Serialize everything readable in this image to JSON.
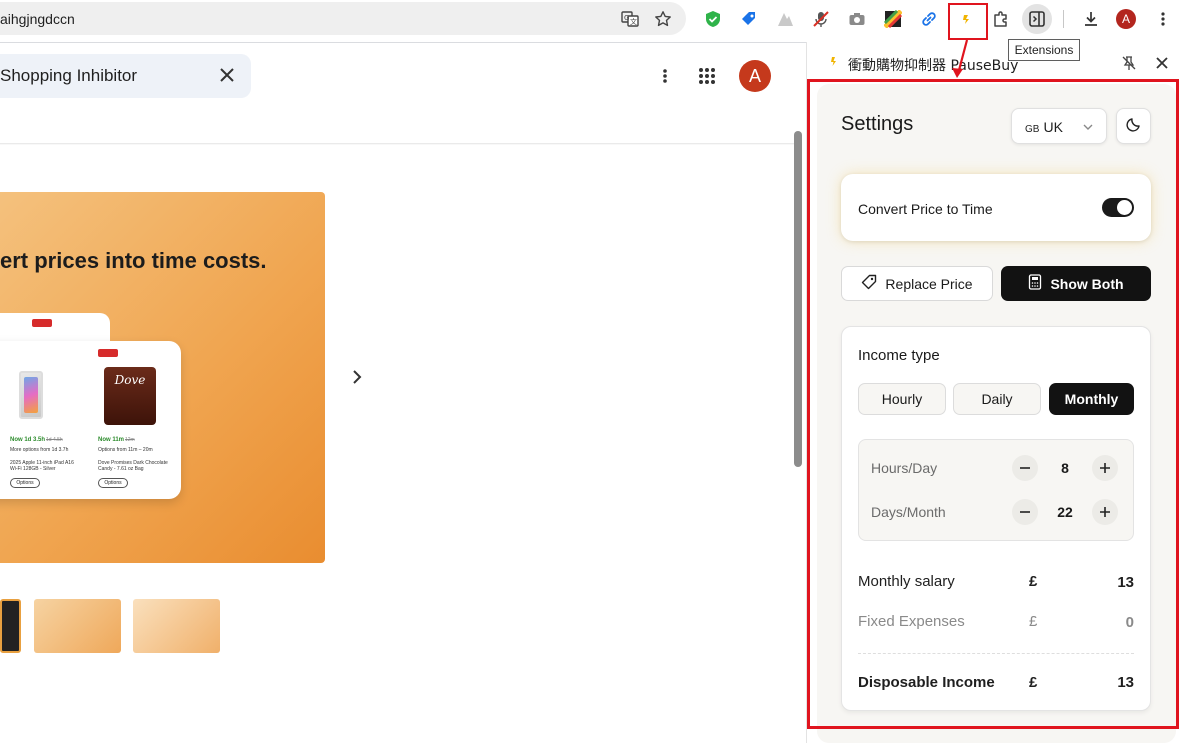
{
  "browser": {
    "url": "aihgjngdccn",
    "tooltip": "Extensions",
    "profile_initial": "A"
  },
  "page": {
    "search_value": "Shopping Inhibitor",
    "profile_initial": "A",
    "hero_title": "ert prices into time costs.",
    "cards": [
      {
        "price_line": "Now 1d 3.5h",
        "strike": "1d 4.5h",
        "options_line": "More options from 1d 3.7h",
        "name": "2025 Apple 11-inch iPad A16 Wi-Fi 128GB - Silver",
        "options_label": "Options"
      },
      {
        "price_line": "Now 11m",
        "strike": "12m",
        "options_line": "Options from 11m – 20m",
        "name": "Dove Promises Dark Chocolate Candy - 7.61 oz Bag",
        "options_label": "Options",
        "brand": "Dove"
      }
    ]
  },
  "panel": {
    "title": "衝動購物抑制器 PauseBuy",
    "settings_title": "Settings",
    "region": {
      "flag": "GB",
      "label": "UK"
    },
    "convert_label": "Convert Price to Time",
    "convert_on": true,
    "mode_buttons": {
      "replace": "Replace Price",
      "both": "Show Both"
    },
    "income": {
      "title": "Income type",
      "types": [
        "Hourly",
        "Daily",
        "Monthly"
      ],
      "selected": "Monthly",
      "hours_label": "Hours/Day",
      "hours_value": "8",
      "days_label": "Days/Month",
      "days_value": "22",
      "salary_label": "Monthly salary",
      "salary_currency": "£",
      "salary_value": "13",
      "expenses_label": "Fixed Expenses",
      "expenses_currency": "£",
      "expenses_value": "0",
      "disposable_label": "Disposable Income",
      "disposable_currency": "£",
      "disposable_value": "13"
    }
  },
  "colors": {
    "accent_dark": "#121212",
    "highlight_red": "#e0141e",
    "hero_orange": "#f0a550"
  }
}
